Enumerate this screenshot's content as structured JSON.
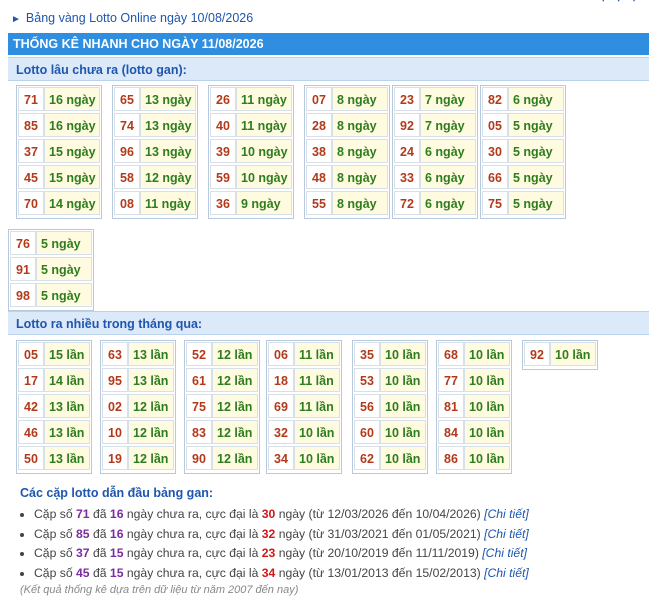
{
  "breadcrumb": "Bảng vàng Lotto Online ngày 10/08/2026",
  "main_title": "THỐNG KÊ NHANH CHO NGÀY 11/08/2026",
  "gan": {
    "title": "Lotto lâu chưa ra (lotto gan):",
    "columns": [
      [
        [
          "71",
          "16 ngày"
        ],
        [
          "85",
          "16 ngày"
        ],
        [
          "37",
          "15 ngày"
        ],
        [
          "45",
          "15 ngày"
        ],
        [
          "70",
          "14 ngày"
        ]
      ],
      [
        [
          "65",
          "13 ngày"
        ],
        [
          "74",
          "13 ngày"
        ],
        [
          "96",
          "13 ngày"
        ],
        [
          "58",
          "12 ngày"
        ],
        [
          "08",
          "11 ngày"
        ]
      ],
      [
        [
          "26",
          "11 ngày"
        ],
        [
          "40",
          "11 ngày"
        ],
        [
          "39",
          "10 ngày"
        ],
        [
          "59",
          "10 ngày"
        ],
        [
          "36",
          "9 ngày"
        ]
      ],
      [
        [
          "07",
          "8 ngày"
        ],
        [
          "28",
          "8 ngày"
        ],
        [
          "38",
          "8 ngày"
        ],
        [
          "48",
          "8 ngày"
        ],
        [
          "55",
          "8 ngày"
        ]
      ],
      [
        [
          "23",
          "7 ngày"
        ],
        [
          "92",
          "7 ngày"
        ],
        [
          "24",
          "6 ngày"
        ],
        [
          "33",
          "6 ngày"
        ],
        [
          "72",
          "6 ngày"
        ]
      ],
      [
        [
          "82",
          "6 ngày"
        ],
        [
          "05",
          "5 ngày"
        ],
        [
          "30",
          "5 ngày"
        ],
        [
          "66",
          "5 ngày"
        ],
        [
          "75",
          "5 ngày"
        ]
      ],
      [
        [
          "76",
          "5 ngày"
        ],
        [
          "91",
          "5 ngày"
        ],
        [
          "98",
          "5 ngày"
        ]
      ]
    ]
  },
  "nhieu": {
    "title": "Lotto ra nhiều trong tháng qua:",
    "columns": [
      [
        [
          "05",
          "15 lần"
        ],
        [
          "17",
          "14 lần"
        ],
        [
          "42",
          "13 lần"
        ],
        [
          "46",
          "13 lần"
        ],
        [
          "50",
          "13 lần"
        ]
      ],
      [
        [
          "63",
          "13 lần"
        ],
        [
          "95",
          "13 lần"
        ],
        [
          "02",
          "12 lần"
        ],
        [
          "10",
          "12 lần"
        ],
        [
          "19",
          "12 lần"
        ]
      ],
      [
        [
          "52",
          "12 lần"
        ],
        [
          "61",
          "12 lần"
        ],
        [
          "75",
          "12 lần"
        ],
        [
          "83",
          "12 lần"
        ],
        [
          "90",
          "12 lần"
        ]
      ],
      [
        [
          "06",
          "11 lần"
        ],
        [
          "18",
          "11 lần"
        ],
        [
          "69",
          "11 lần"
        ],
        [
          "32",
          "10 lần"
        ],
        [
          "34",
          "10 lần"
        ]
      ],
      [
        [
          "35",
          "10 lần"
        ],
        [
          "53",
          "10 lần"
        ],
        [
          "56",
          "10 lần"
        ],
        [
          "60",
          "10 lần"
        ],
        [
          "62",
          "10 lần"
        ]
      ],
      [
        [
          "68",
          "10 lần"
        ],
        [
          "77",
          "10 lần"
        ],
        [
          "81",
          "10 lần"
        ],
        [
          "84",
          "10 lần"
        ],
        [
          "86",
          "10 lần"
        ]
      ],
      [
        [
          "92",
          "10 lần"
        ]
      ]
    ]
  },
  "pairs": {
    "title": "Các cặp lotto dẫn đầu bảng gan:",
    "prefix": "Cặp số",
    "da": "đã",
    "mid": "ngày chưa ra, cực đại là",
    "ngay": "ngày",
    "from_word": "(từ",
    "to_word": "đến",
    "close": ")",
    "link": "[Chi tiết]",
    "items": [
      {
        "num": "71",
        "days": "16",
        "max": "30",
        "from": "12/03/2026",
        "to": "10/04/2026"
      },
      {
        "num": "85",
        "days": "16",
        "max": "32",
        "from": "31/03/2021",
        "to": "01/05/2021"
      },
      {
        "num": "37",
        "days": "15",
        "max": "23",
        "from": "20/10/2019",
        "to": "11/11/2019"
      },
      {
        "num": "45",
        "days": "15",
        "max": "34",
        "from": "13/01/2013",
        "to": "15/02/2013"
      }
    ]
  },
  "footnote": "(Kết quả thống kê dựa trên dữ liệu từ năm 2007 đến nay)",
  "colors": {
    "header": "#2f8ee0",
    "subheader": "#dbe9f8",
    "number": "#b23a1a",
    "value": "#2e7d1e",
    "purple": "#7b2ca0",
    "red": "#d01818"
  }
}
